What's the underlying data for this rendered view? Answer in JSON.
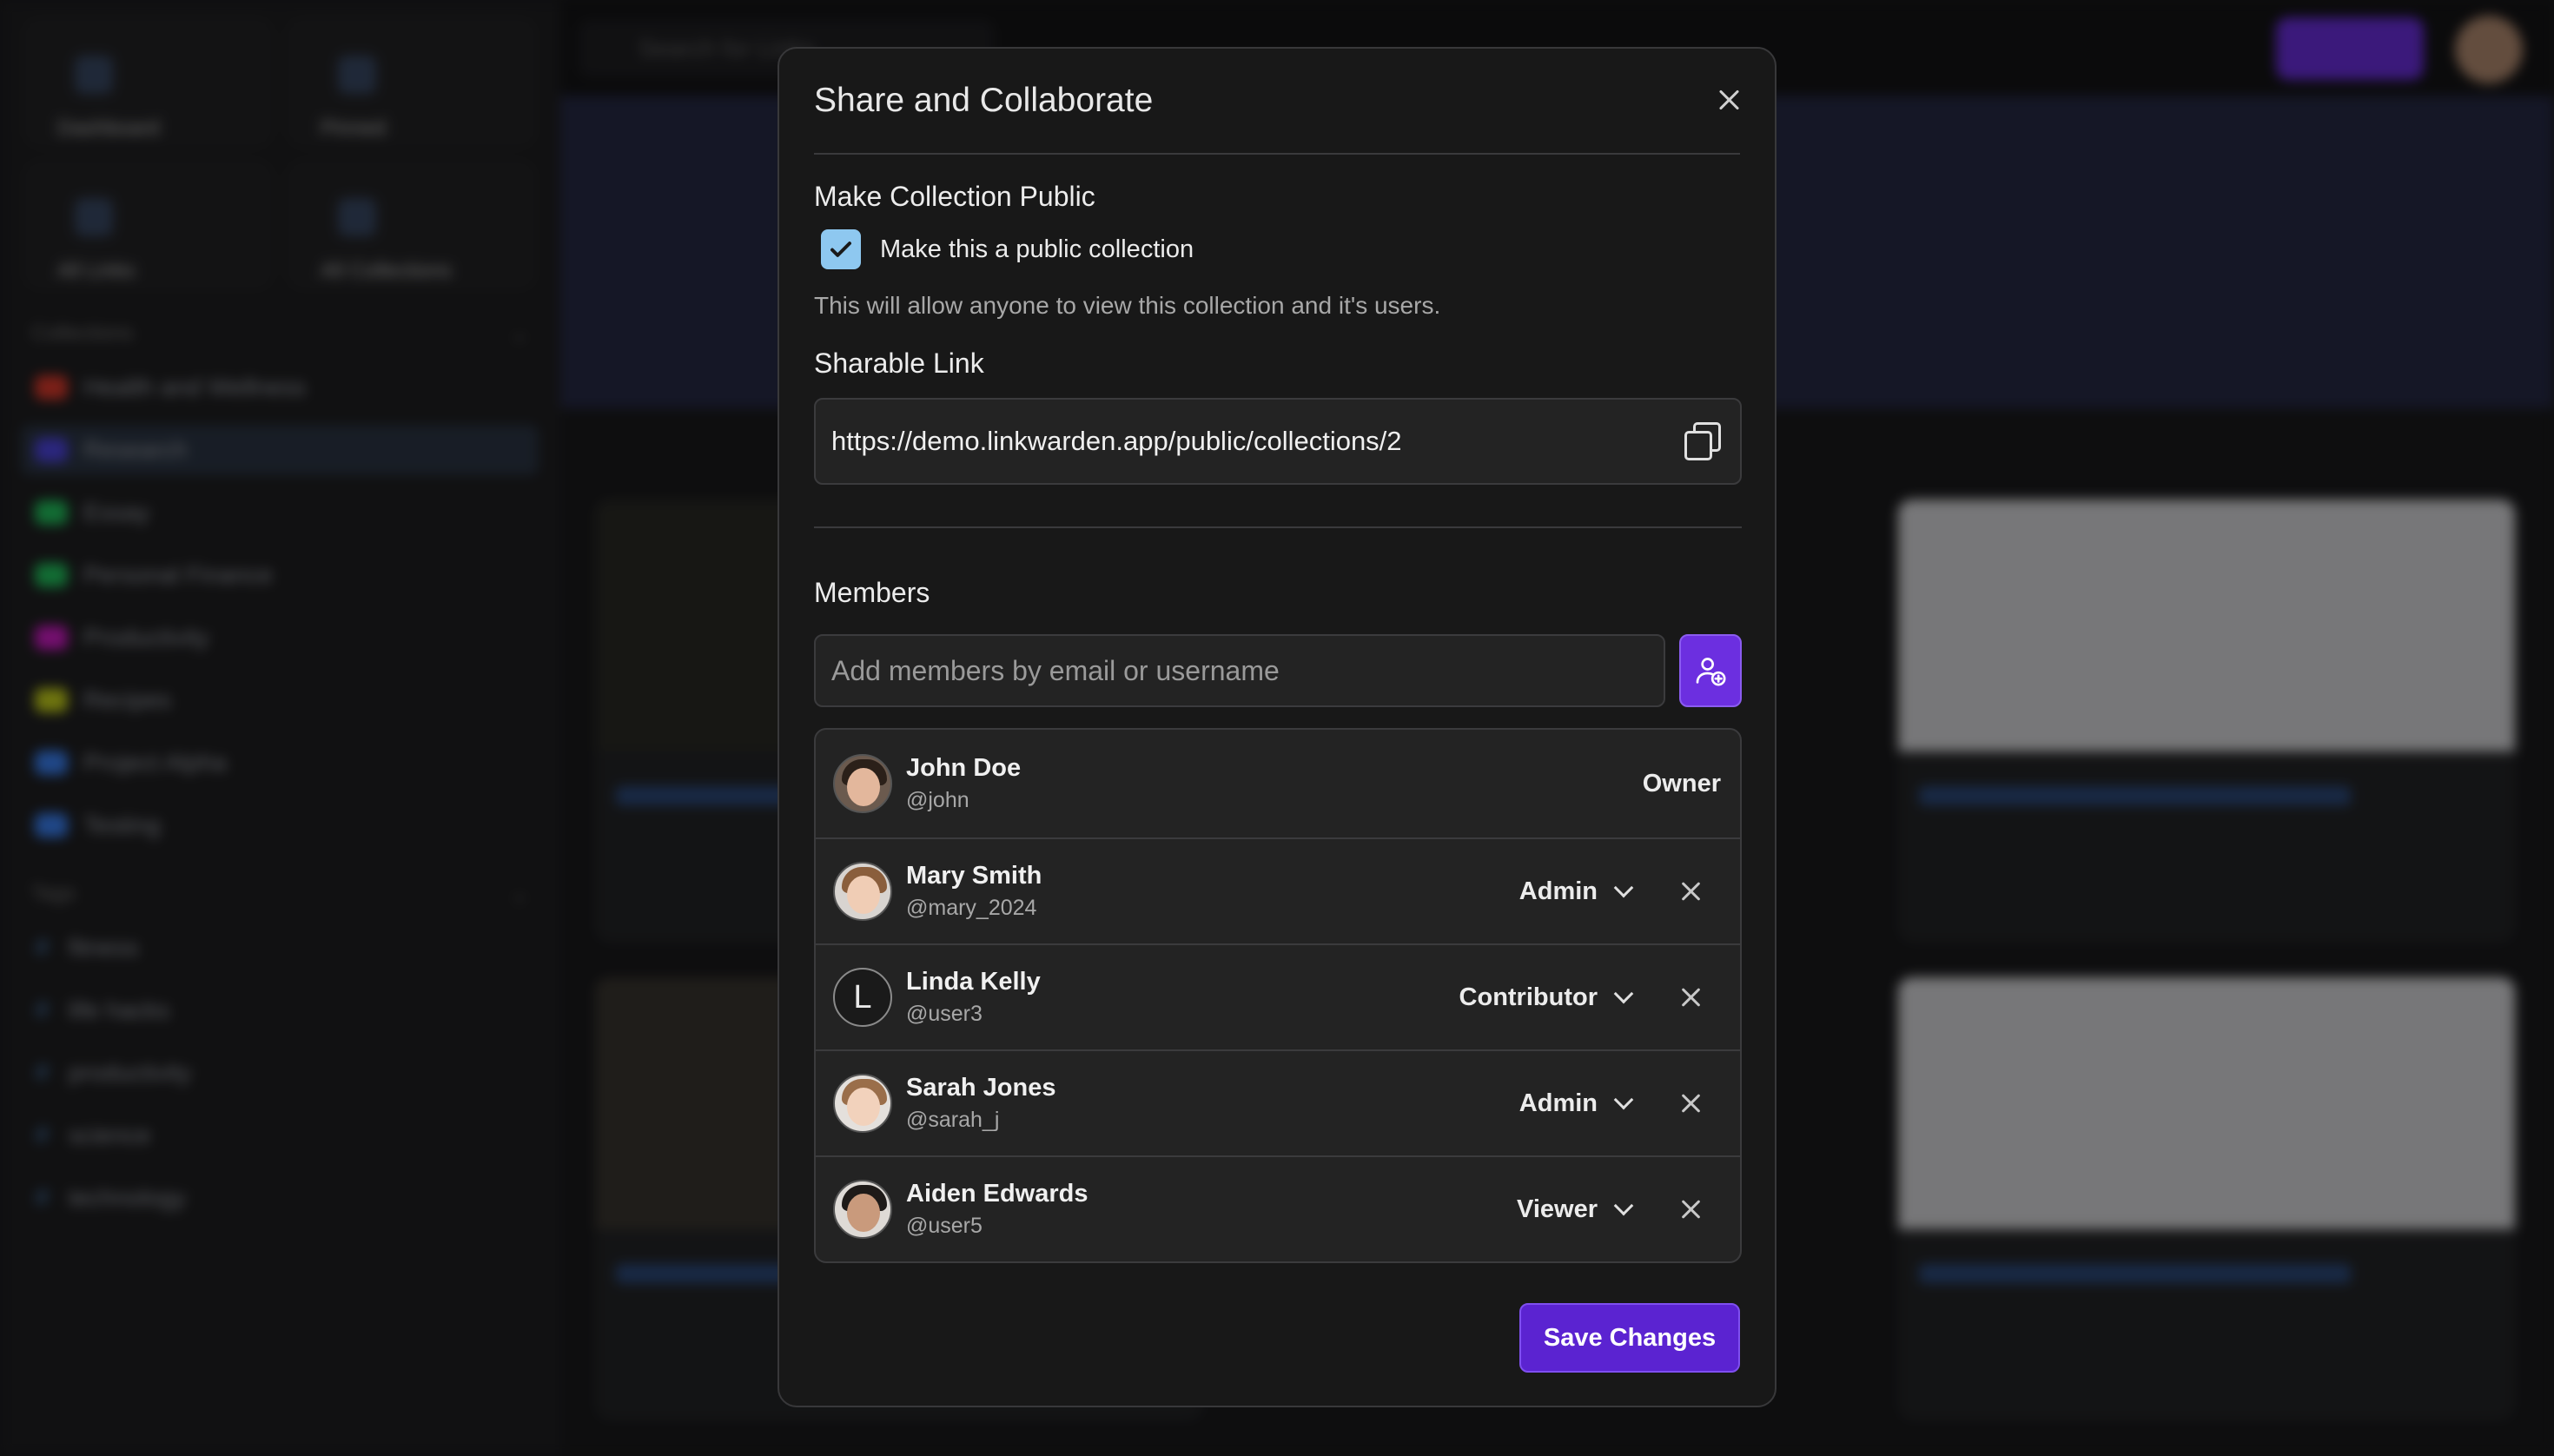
{
  "background": {
    "sidebar_tiles": [
      "Dashboard",
      "Pinned",
      "All Links",
      "All Collections"
    ],
    "collections_heading": "Collections",
    "collections": [
      {
        "label": "Health and Wellness",
        "color": "#e03b2c"
      },
      {
        "label": "Research",
        "color": "#4f46e5"
      },
      {
        "label": "Essay",
        "color": "#22c55e"
      },
      {
        "label": "Personal Finance",
        "color": "#22c55e"
      },
      {
        "label": "Productivity",
        "color": "#d21cc9"
      },
      {
        "label": "Recipes",
        "color": "#c8d31c"
      },
      {
        "label": "Project Alpha",
        "color": "#3b82f6"
      },
      {
        "label": "Testing",
        "color": "#3b82f6"
      }
    ],
    "tags_heading": "Tags",
    "tags": [
      "fitness",
      "life hacks",
      "productivity",
      "science",
      "technology"
    ],
    "search_placeholder": "Search for Links"
  },
  "modal": {
    "title": "Share and Collaborate",
    "public_section_title": "Make Collection Public",
    "public_checkbox_label": "Make this a public collection",
    "public_checked": true,
    "public_hint": "This will allow anyone to view this collection and it's users.",
    "link_section_title": "Sharable Link",
    "link_url": "https://demo.linkwarden.app/public/collections/2",
    "members_section_title": "Members",
    "member_input_placeholder": "Add members by email or username",
    "members": [
      {
        "name": "John Doe",
        "handle": "@john",
        "role": "Owner"
      },
      {
        "name": "Mary Smith",
        "handle": "@mary_2024",
        "role": "Admin"
      },
      {
        "name": "Linda Kelly",
        "handle": "@user3",
        "role": "Contributor",
        "initial": "L"
      },
      {
        "name": "Sarah Jones",
        "handle": "@sarah_j",
        "role": "Admin"
      },
      {
        "name": "Aiden Edwards",
        "handle": "@user5",
        "role": "Viewer"
      }
    ],
    "save_label": "Save Changes"
  },
  "colors": {
    "accent": "#6c2fe0",
    "checkbox": "#8ec8f0"
  }
}
